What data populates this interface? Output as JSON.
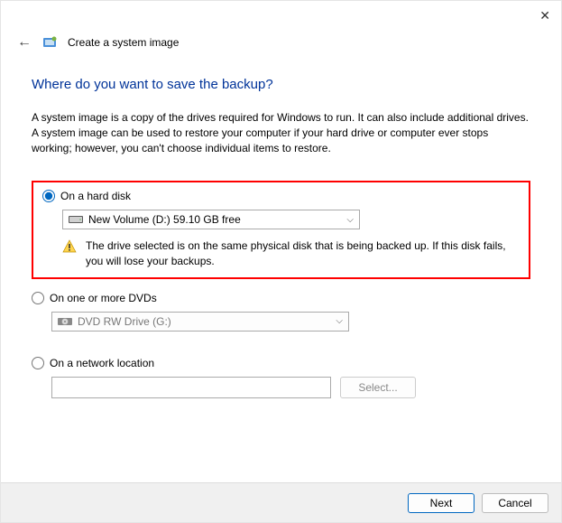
{
  "titlebar": {
    "app_title": "Create a system image"
  },
  "main": {
    "heading": "Where do you want to save the backup?",
    "description": "A system image is a copy of the drives required for Windows to run. It can also include additional drives. A system image can be used to restore your computer if your hard drive or computer ever stops working; however, you can't choose individual items to restore."
  },
  "options": {
    "hard_disk": {
      "label": "On a hard disk",
      "selected_drive": "New Volume (D:)  59.10 GB free",
      "warning": "The drive selected is on the same physical disk that is being backed up. If this disk fails, you will lose your backups."
    },
    "dvd": {
      "label": "On one or more DVDs",
      "selected_drive": "DVD RW Drive (G:)"
    },
    "network": {
      "label": "On a network location",
      "value": "",
      "select_button": "Select..."
    }
  },
  "footer": {
    "next": "Next",
    "cancel": "Cancel"
  }
}
